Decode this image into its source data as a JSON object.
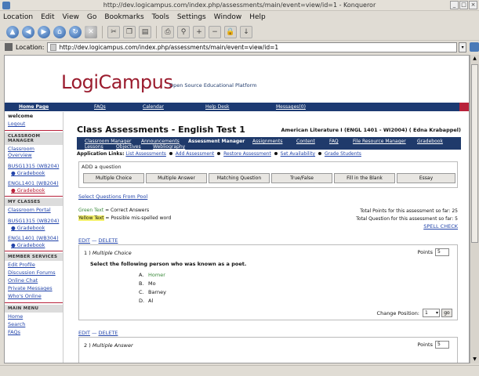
{
  "window": {
    "title": "http://dev.logicampus.com/index.php/assessments/main/event=view/id=1 - Konqueror"
  },
  "menu": [
    "Location",
    "Edit",
    "View",
    "Go",
    "Bookmarks",
    "Tools",
    "Settings",
    "Window",
    "Help"
  ],
  "location": {
    "label": "Location:",
    "url": "http://dev.logicampus.com/index.php/assessments/main/event=view/id=1"
  },
  "site": {
    "logo": "LogiCampus",
    "tagline": "Open Source Educational Platform",
    "topnav": {
      "home": "Home Page",
      "tabs": [
        "FAQs",
        "Calendar",
        "Help Desk",
        "Messages(0)"
      ]
    }
  },
  "sidebar": {
    "welcome": "welcome",
    "logout": "Logout",
    "classroom_manager_header": "CLASSROOM MANAGER",
    "classroom_overview": "Classroom Overview",
    "cm_courses": [
      {
        "name": "BUSG1315 (WB204)",
        "sub": "Gradebook"
      },
      {
        "name": "ENGL1401 (WB204)",
        "sub": "Gradebook"
      }
    ],
    "my_classes_header": "MY CLASSES",
    "classroom_portal": "Classroom Portal",
    "my_courses": [
      {
        "name": "BUSG1315 (WB204)",
        "sub": "Gradebook"
      },
      {
        "name": "ENGL1401 (WB304)",
        "sub": "Gradebook"
      }
    ],
    "member_services_header": "MEMBER SERVICES",
    "member_services": [
      "Edit Profile",
      "Discussion Forums",
      "Online Chat",
      "Private Messages",
      "Who's Online"
    ],
    "main_menu_header": "MAIN MENU",
    "main_menu": [
      "Home",
      "Search",
      "FAQs"
    ]
  },
  "page": {
    "title": "Class Assessments - English Test 1",
    "course": "American Literature I (ENGL 1401 - WI2004) ( Edna Krabappel)",
    "subnav_row1": [
      "Classroom Manager",
      "Announcements",
      "Assessment Manager",
      "Assignments",
      "Content",
      "FAQ",
      "File Resource Manager",
      "Gradebook"
    ],
    "subnav_row2": [
      "Lessons",
      "Objectives",
      "Webliography"
    ],
    "applinks_label": "Application Links:",
    "applinks": [
      "List Assessments",
      "Add Assessment",
      "Restore Assessment",
      "Set Availability",
      "Grade Students"
    ],
    "add_question": {
      "title": "ADD a question",
      "buttons": [
        "Multiple Choice",
        "Multiple Answer",
        "Matching Question",
        "True/False",
        "Fill in the Blank",
        "Essay"
      ]
    },
    "select_pool": "Select Questions From Pool",
    "legend_green_text": "Green Text",
    "legend_green_desc": " = Correct Answers",
    "legend_yellow_text": "Yellow Text",
    "legend_yellow_desc": " = Possible mis-spelled word",
    "total_points": "Total Points for this assessment so far: 25",
    "total_questions": "Total Question for this assessment so far: 5",
    "spell_check": "SPELL CHECK",
    "edit": "EDIT",
    "delete": "DELETE",
    "q1": {
      "number": "1 )",
      "type": "Multiple Choice",
      "points_label": "Points",
      "points": "5",
      "prompt": "Select the following person who was known as a poet.",
      "choices": [
        {
          "letter": "A.",
          "text": "Homer"
        },
        {
          "letter": "B.",
          "text": "Mo"
        },
        {
          "letter": "C.",
          "text": "Barney"
        },
        {
          "letter": "D.",
          "text": "Al"
        }
      ],
      "change_position_label": "Change Position:",
      "position": "1",
      "go": "go"
    },
    "q2": {
      "number": "2 )",
      "type": "Multiple Answer",
      "points_label": "Points",
      "points": "5"
    }
  }
}
